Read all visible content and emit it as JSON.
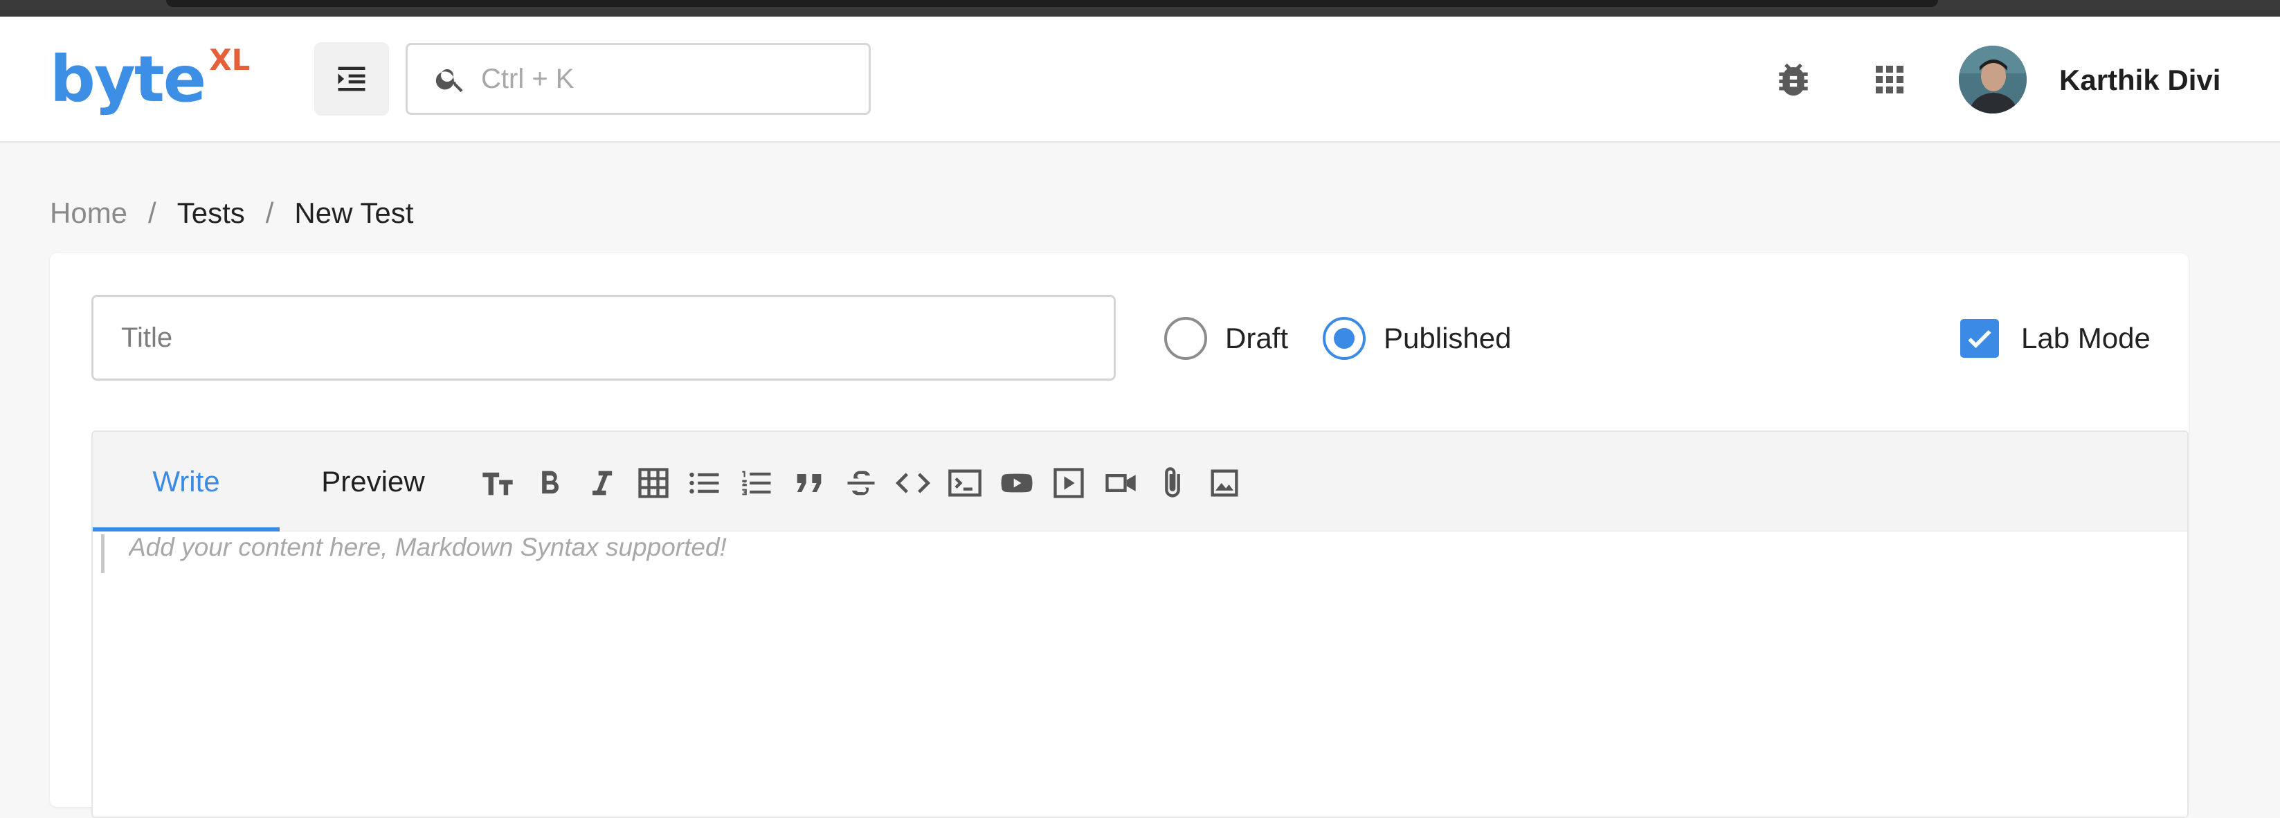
{
  "header": {
    "logo_main": "byte",
    "logo_sup": "XL",
    "search_placeholder": "Ctrl + K",
    "user_name": "Karthik Divi"
  },
  "breadcrumb": [
    "Home",
    "Tests",
    "New Test"
  ],
  "form": {
    "title_placeholder": "Title",
    "status_options": [
      {
        "label": "Draft",
        "checked": false
      },
      {
        "label": "Published",
        "checked": true
      }
    ],
    "lab_mode": {
      "label": "Lab Mode",
      "checked": true
    }
  },
  "editor": {
    "tabs": [
      "Write",
      "Preview"
    ],
    "active_tab": "Write",
    "placeholder": "Add your content here, Markdown Syntax supported!",
    "toolbar_icons": [
      "heading-icon",
      "bold-icon",
      "italic-icon",
      "table-icon",
      "bullet-list-icon",
      "numbered-list-icon",
      "quote-icon",
      "strikethrough-icon",
      "code-icon",
      "terminal-icon",
      "youtube-icon",
      "video-play-icon",
      "video-camera-icon",
      "attachment-icon",
      "image-icon"
    ]
  },
  "colors": {
    "accent": "#3b8ae6",
    "logo_blue": "#3d8fe6",
    "logo_orange": "#e6613a"
  }
}
